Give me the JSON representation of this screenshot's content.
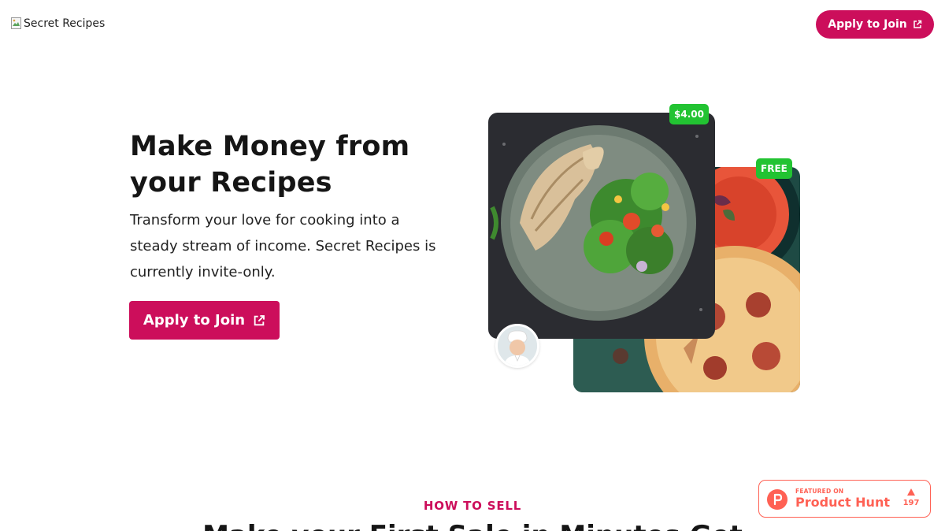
{
  "header": {
    "logo_alt": "Secret Recipes",
    "cta_label": "Apply to Join"
  },
  "hero": {
    "title": "Make Money from your Recipes",
    "subtitle": "Transform your love for cooking into a steady stream of income. Secret Recipes is currently invite-only.",
    "cta_label": "Apply to Join",
    "cards": [
      {
        "price": "$4.00",
        "image": "chicken-salad-photo"
      },
      {
        "price": "FREE",
        "image": "pizza-soup-photo"
      }
    ]
  },
  "section": {
    "kicker": "HOW TO SELL",
    "heading": "Make your First Sale in Minutes Get"
  },
  "product_hunt": {
    "featured": "FEATURED ON",
    "name": "Product Hunt",
    "votes": "197"
  },
  "colors": {
    "brand": "#cc0e5b",
    "price_tag": "#22c332",
    "product_hunt": "#ff6154"
  }
}
